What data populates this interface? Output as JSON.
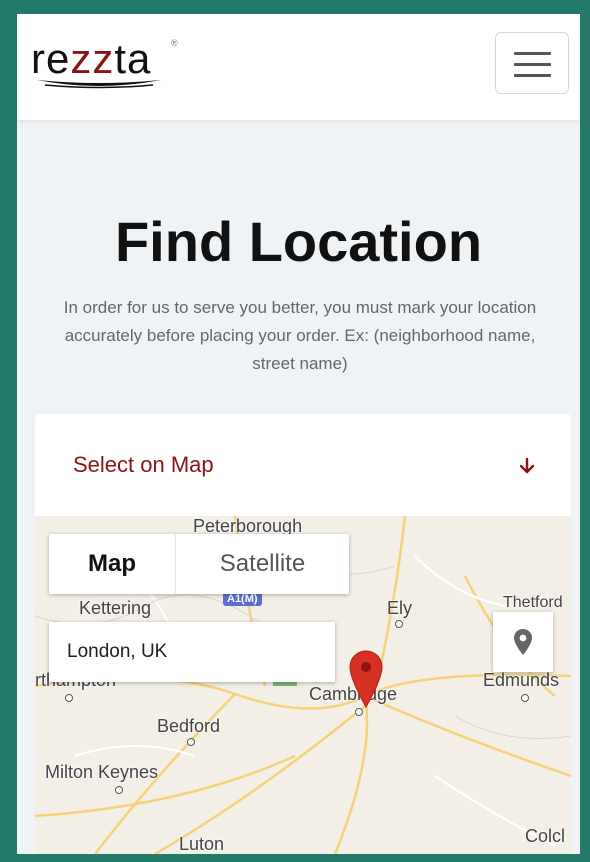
{
  "header": {
    "logo_text": "rezzta",
    "logo_icon": "rezzta-logo",
    "menu_icon": "hamburger-icon"
  },
  "main": {
    "title": "Find Location",
    "description": "In order for us to serve you better, you must mark your location accurately before placing your order. Ex: (neighborhood name, street name)"
  },
  "accordion": {
    "label": "Select on Map",
    "icon": "arrow-down-icon"
  },
  "map": {
    "type_tabs": [
      "Map",
      "Satellite"
    ],
    "selected_tab": "Map",
    "search_value": "London, UK",
    "locate_icon": "location-pin-icon",
    "marker_icon": "map-marker-icon",
    "places": {
      "peterborough": "Peterborough",
      "kettering": "Kettering",
      "ely": "Ely",
      "thetford": "Thetford",
      "northampton": "rthampton",
      "cambridge": "Cambridge",
      "edmunds": "Edmunds",
      "bedford": "Bedford",
      "milton_keynes": "Milton Keynes",
      "luton": "Luton",
      "colchester": "Colcl"
    },
    "road_shield": "A1(M)",
    "colors": {
      "brand": "#8a1414",
      "marker": "#d93025",
      "frame": "#237a6a"
    }
  }
}
